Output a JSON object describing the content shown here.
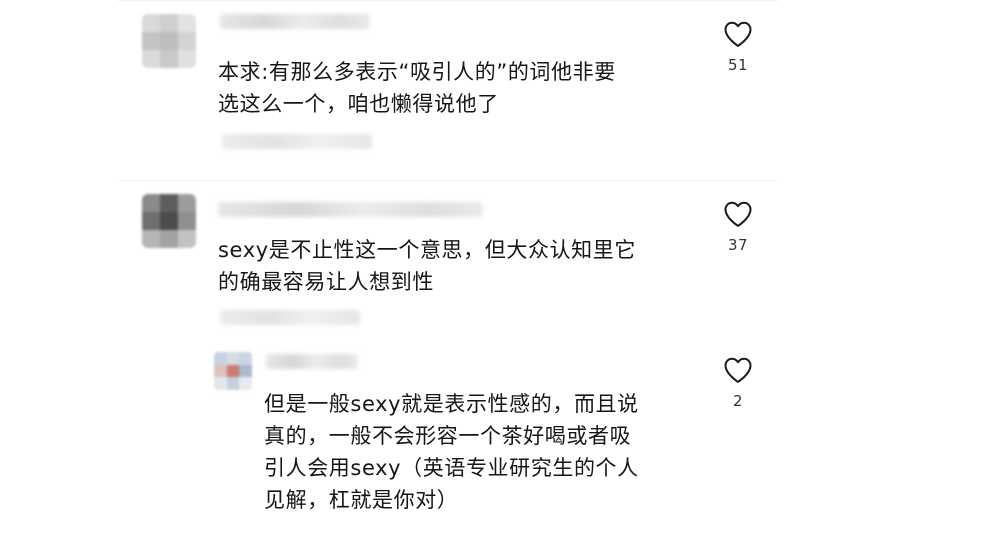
{
  "comments": [
    {
      "text": "本求:有那么多表示“吸引人的”的词他非要\n选这么一个，咱也懒得说他了",
      "likes": "51",
      "icon": "heart-outline-icon"
    },
    {
      "text": "sexy是不止性这一个意思，但大众认知里它\n的确最容易让人想到性",
      "likes": "37",
      "icon": "heart-outline-icon"
    },
    {
      "text": "但是一般sexy就是表示性感的，而且说\n真的，一般不会形容一个茶好喝或者吸\n引人会用sexy（英语专业研究生的个人\n见解，杠就是你对）",
      "likes": "2",
      "icon": "heart-outline-icon",
      "is_reply": true
    }
  ],
  "colors": {
    "text": "#161616",
    "count": "#333333",
    "heart": "#1a1a1a",
    "blur_placeholder": "#dcdcdc"
  }
}
